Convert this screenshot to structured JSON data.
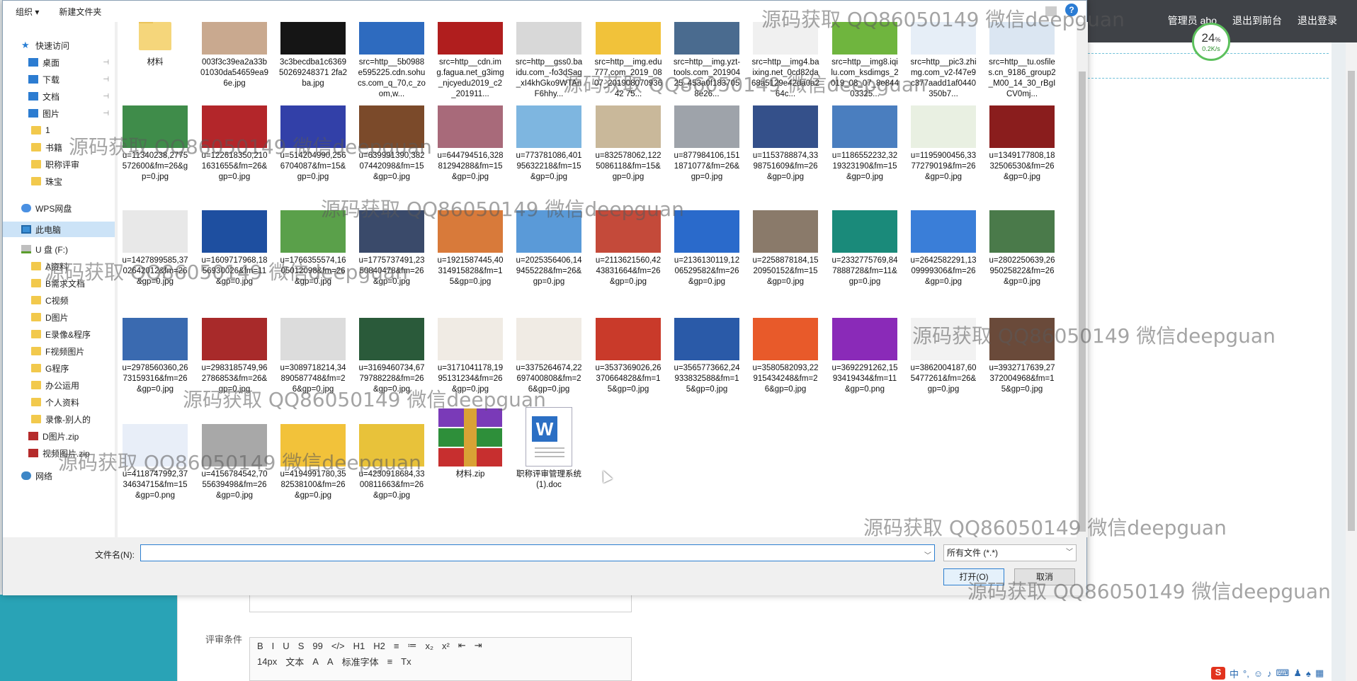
{
  "background_page": {
    "admin_links": [
      "管理员 abo",
      "退出到前台",
      "退出登录"
    ],
    "speed_percent": "24",
    "speed_rate": "0.2K/s",
    "field_label": "评审条件",
    "editor_row1": [
      "B",
      "I",
      "U",
      "S",
      "99",
      "</>",
      "H1",
      "H2",
      "≡",
      "≔",
      "x₂",
      "x²",
      "⇤",
      "⇥"
    ],
    "editor_row2": [
      "14px",
      "文本",
      "A",
      "A",
      "标准字体",
      "≡",
      "Tx"
    ]
  },
  "dialog": {
    "toolbar": {
      "organize": "组织 ▾",
      "new_folder": "新建文件夹"
    },
    "nav_items": [
      {
        "label": "快速访问",
        "icon": "star-icon"
      },
      {
        "label": "桌面",
        "icon": "desktop-icon"
      },
      {
        "label": "下载",
        "icon": "download-icon"
      },
      {
        "label": "文档",
        "icon": "document-icon"
      },
      {
        "label": "图片",
        "icon": "pictures-icon"
      },
      {
        "label": "1",
        "icon": "folder-icon"
      },
      {
        "label": "书籍",
        "icon": "folder-icon"
      },
      {
        "label": "职称评审",
        "icon": "folder-icon"
      },
      {
        "label": "珠宝",
        "icon": "folder-icon"
      },
      {
        "label": "WPS网盘",
        "icon": "cloud-icon"
      },
      {
        "label": "此电脑",
        "icon": "computer-icon"
      },
      {
        "label": "U 盘 (F:)",
        "icon": "drive-icon"
      },
      {
        "label": "A资料",
        "icon": "folder-icon"
      },
      {
        "label": "B需求文档",
        "icon": "folder-icon"
      },
      {
        "label": "C视频",
        "icon": "folder-icon"
      },
      {
        "label": "D图片",
        "icon": "folder-icon"
      },
      {
        "label": "E录像&程序",
        "icon": "folder-icon"
      },
      {
        "label": "F视频图片",
        "icon": "folder-icon"
      },
      {
        "label": "G程序",
        "icon": "folder-icon"
      },
      {
        "label": "办公运用",
        "icon": "folder-icon"
      },
      {
        "label": "个人资料",
        "icon": "folder-icon"
      },
      {
        "label": "录像-别人的",
        "icon": "folder-icon"
      },
      {
        "label": "D图片.zip",
        "icon": "zip-icon"
      },
      {
        "label": "视频图片.zip",
        "icon": "zip-icon"
      },
      {
        "label": "网络",
        "icon": "network-icon"
      }
    ],
    "files_row0": [
      {
        "name": "材料",
        "kind": "folder"
      },
      {
        "name": "003f3c39ea2a33b01030da54659ea96e.jpg",
        "color": "#c9a98f"
      },
      {
        "name": "3c3becdba1c636950269248371 2fa2ba.jpg",
        "color": "#151515"
      },
      {
        "name": "src=http__5b0988e595225.cdn.sohucs.com_q_70,c_zoom,w...",
        "color": "#2e6bbf"
      },
      {
        "name": "src=http__cdn.img.fagua.net_g3img_njcyedu2019_c2_201911...",
        "color": "#b01e1e"
      },
      {
        "name": "src=http__gss0.baidu.com_-fo3dSag_xI4khGko9WTAnF6hhy...",
        "color": "#d8d8d8"
      },
      {
        "name": "src=http__img.edu777.com_2019_0807_20190807093642 75...",
        "color": "#f1c23a"
      },
      {
        "name": "src=http__img.yzt-tools.com_20190425_453a0f1837058e26...",
        "color": "#4a6b8f"
      },
      {
        "name": "src=http__img4.baixing.net_0cd82da68a5129e42da0a264c...",
        "color": "#f0f0f0"
      },
      {
        "name": "src=http__img8.iqilu.com_ksdimgs_2019_08_07_8e84403325...",
        "color": "#6fb53e"
      },
      {
        "name": "src=http__pic3.zhimg.com_v2-f47e9c377aadd1af0440350b7...",
        "color": "#e6eef7"
      },
      {
        "name": "src=http__tu.osfiles.cn_9186_group2_M00_14_30_rBgICV0mj...",
        "color": "#dbe6f2"
      }
    ],
    "files_row1": [
      {
        "name": "u=11340238,2775572600&fm=26&gp=0.jpg",
        "color": "#3f8c4a"
      },
      {
        "name": "u=122618350,2101631655&fm=26&gp=0.jpg",
        "color": "#b3262a"
      },
      {
        "name": "u=514204990,2566704087&fm=15&gp=0.jpg",
        "color": "#3240a8"
      },
      {
        "name": "u=639991390,38207442098&fm=15&gp=0.jpg",
        "color": "#7b4a2a"
      },
      {
        "name": "u=644794516,32881294288&fm=15&gp=0.jpg",
        "color": "#a86a7a"
      },
      {
        "name": "u=773781086,40195632218&fm=15&gp=0.jpg",
        "color": "#7eb6e0"
      },
      {
        "name": "u=832578062,1225086118&fm=15&gp=0.jpg",
        "color": "#c9b89a"
      },
      {
        "name": "u=877984106,1511871077&fm=26&gp=0.jpg",
        "color": "#9ea3aa"
      },
      {
        "name": "u=1153788874,3398751609&fm=26&gp=0.jpg",
        "color": "#34508a"
      },
      {
        "name": "u=1186552232,3219323190&fm=15&gp=0.jpg",
        "color": "#4a7ebf"
      },
      {
        "name": "u=1195900456,3377279019&fm=26&gp=0.jpg",
        "color": "#e9f0e2"
      },
      {
        "name": "u=1349177808,1832506530&fm=26&gp=0.jpg",
        "color": "#8a1d1d"
      }
    ],
    "files_row2": [
      {
        "name": "u=1427899585,3702642012&fm=26&gp=0.jpg",
        "color": "#e8e8e8"
      },
      {
        "name": "u=1609717968,1856930026&fm=11&gp=0.jpg",
        "color": "#1e4fa0"
      },
      {
        "name": "u=1766355574,1605012098&fm=26&gp=0.jpg",
        "color": "#5aa04a"
      },
      {
        "name": "u=1775737491,2350840478&fm=26&gp=0.jpg",
        "color": "#3a4a6a"
      },
      {
        "name": "u=1921587445,40314915828&fm=15&gp=0.jpg",
        "color": "#d87a3a"
      },
      {
        "name": "u=2025356406,149455228&fm=26&gp=0.jpg",
        "color": "#5a9ad8"
      },
      {
        "name": "u=2113621560,4243831664&fm=26&gp=0.jpg",
        "color": "#c44a3a"
      },
      {
        "name": "u=2136130119,1206529582&fm=26&gp=0.jpg",
        "color": "#2a6acb"
      },
      {
        "name": "u=2258878184,1520950152&fm=15&gp=0.jpg",
        "color": "#8a7a6a"
      },
      {
        "name": "u=2332775769,847888728&fm=11&gp=0.jpg",
        "color": "#1a8a7a"
      },
      {
        "name": "u=2642582291,1309999306&fm=26&gp=0.jpg",
        "color": "#3a7ed8"
      },
      {
        "name": "u=2802250639,2695025822&fm=26&gp=0.jpg",
        "color": "#4a7a4a"
      }
    ],
    "files_row3": [
      {
        "name": "u=2978560360,2673159316&fm=26&gp=0.jpg",
        "color": "#3a6ab0"
      },
      {
        "name": "u=2983185749,962786853&fm=26&gp=0.jpg",
        "color": "#a82a2a"
      },
      {
        "name": "u=3089718214,34890587748&fm=26&gp=0.jpg",
        "color": "#dcdcdc"
      },
      {
        "name": "u=3169460734,6779788228&fm=26&gp=0.jpg",
        "color": "#2a5a3a"
      },
      {
        "name": "u=3171041178,1995131234&fm=26&gp=0.jpg",
        "color": "#f0ebe4"
      },
      {
        "name": "u=3375264674,22697400808&fm=26&gp=0.jpg",
        "color": "#f0ebe4"
      },
      {
        "name": "u=3537369026,26370664828&fm=15&gp=0.jpg",
        "color": "#c93a2a"
      },
      {
        "name": "u=3565773662,24933832588&fm=15&gp=0.jpg",
        "color": "#2a5aa8"
      },
      {
        "name": "u=3580582093,22915434248&fm=26&gp=0.jpg",
        "color": "#e85a2a"
      },
      {
        "name": "u=3692291262,1593419434&fm=11&gp=0.png",
        "color": "#8a2ab8"
      },
      {
        "name": "u=3862004187,605477261&fm=26&gp=0.jpg",
        "color": "#f2f2f2"
      },
      {
        "name": "u=3932717639,27372004968&fm=15&gp=0.jpg",
        "color": "#6a4a3a"
      }
    ],
    "files_row4": [
      {
        "name": "u=4118747992,3734634715&fm=15&gp=0.png",
        "color": "#e8eef8"
      },
      {
        "name": "u=4156784542,7055639498&fm=26&gp=0.jpg",
        "color": "#a8a8a8"
      },
      {
        "name": "u=4194991780,3582538100&fm=26&gp=0.jpg",
        "color": "#f2c23a"
      },
      {
        "name": "u=4230918684,3300811663&fm=26&gp=0.jpg",
        "color": "#e8c23a"
      },
      {
        "name": "材料.zip",
        "kind": "zip"
      },
      {
        "name": "职称评审管理系统 (1).doc",
        "kind": "doc"
      }
    ],
    "filename_label": "文件名(N):",
    "filename_value": "",
    "filetype": "所有文件 (*.*)",
    "open_button": "打开(O)",
    "cancel_button": "取消",
    "help": "?"
  },
  "watermark": "源码获取 QQ86050149 微信deepguan"
}
